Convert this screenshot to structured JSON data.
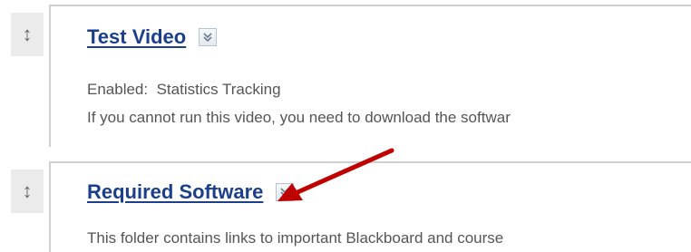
{
  "items": [
    {
      "title": "Test Video",
      "enabled_label": "Enabled:",
      "enabled_value": "Statistics Tracking",
      "description": "If you cannot run this video, you need to download the softwar"
    },
    {
      "title": "Required Software",
      "description": "This folder contains links to important Blackboard and course"
    }
  ],
  "icons": {
    "drag_handle": "vertical-double-arrow-icon",
    "menu_button": "double-chevron-down-icon"
  },
  "colors": {
    "title_link": "#1b3f8b",
    "annotation_arrow": "#c00000"
  }
}
